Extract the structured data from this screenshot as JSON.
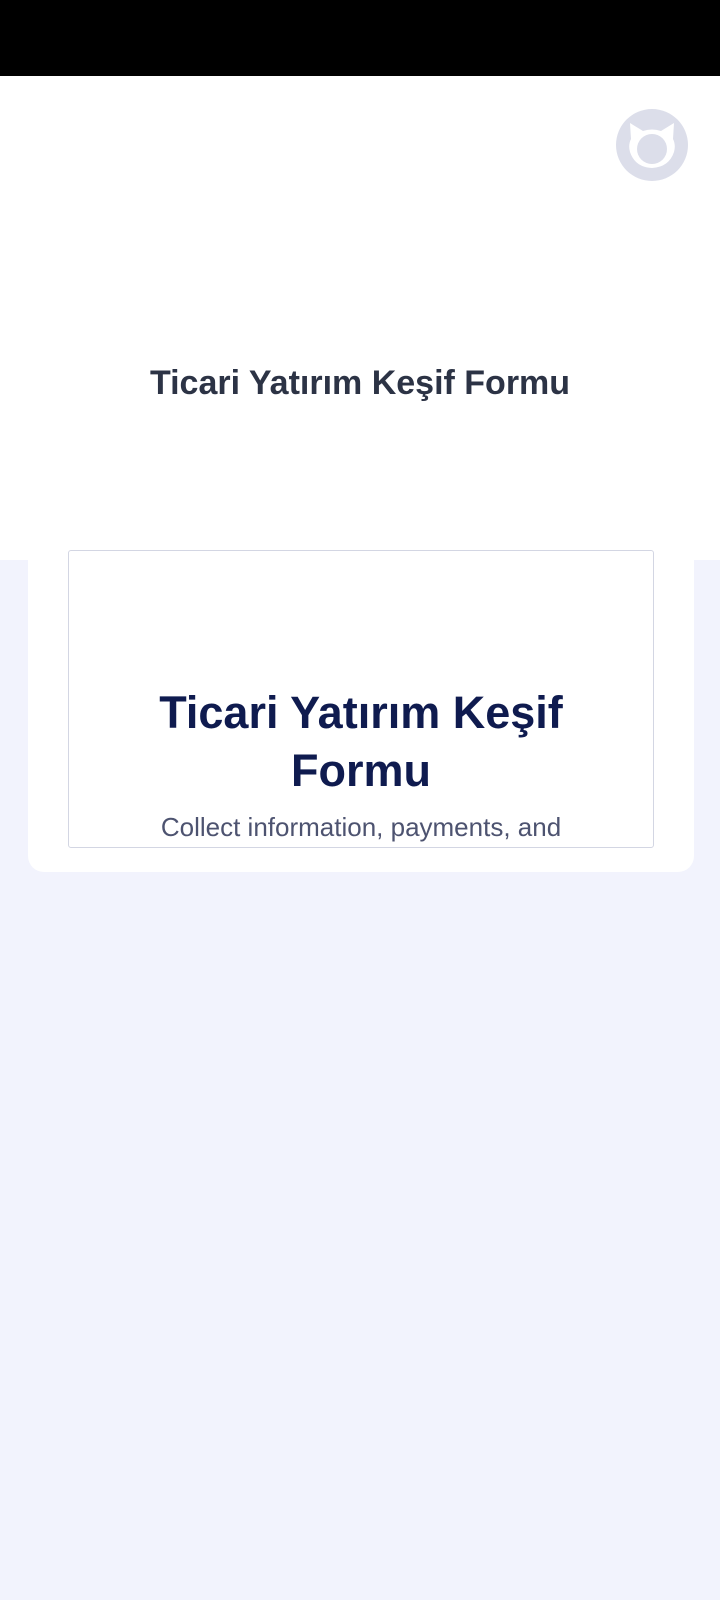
{
  "header": {
    "title": "Ticari Yatırım Keşif Formu",
    "avatar_icon": "jotform-cat-avatar-icon"
  },
  "preview": {
    "title": "Ticari Yatırım Keşif Formu",
    "description": "Collect information, payments, and"
  },
  "colors": {
    "status_bar": "#000000",
    "header_bg": "#ffffff",
    "page_bg": "#f2f3fd",
    "header_title": "#2c3345",
    "preview_title": "#0f1b4f",
    "preview_description": "#4d5370",
    "avatar_bg": "#dcdeea"
  }
}
